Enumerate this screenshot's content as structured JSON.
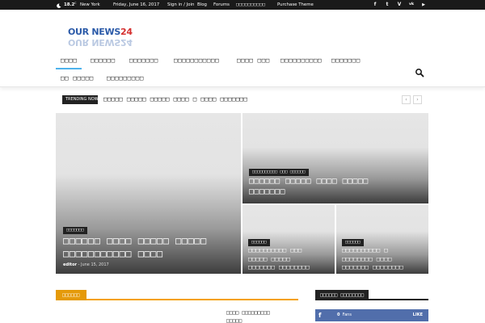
{
  "topbar": {
    "temperature": "18.2",
    "temp_unit": "C",
    "city": "New York",
    "date": "Friday, June 16, 2017",
    "links": [
      "Sign in / Join",
      "Blog",
      "Forums",
      "□□□□□□□□□□",
      "Purchase Theme"
    ],
    "social": [
      "f",
      "t",
      "V",
      "vk",
      "▶"
    ]
  },
  "logo": {
    "text_blue": "OUR NEWS",
    "text_red": "24"
  },
  "nav": {
    "items": [
      "□□□□",
      "□□□□□□",
      "□□□□□□□",
      "□□□□□□□□□□□",
      "□□□□ □□□",
      "□□□□□□□□□□",
      "□□□□□□□",
      "□□ □□□□□",
      "□□□□□□□□□"
    ],
    "active_index": 0
  },
  "trending": {
    "label": "TRENDING NOW",
    "title": "□□□□□ □□□□□ □□□□□ □□□□ □ □□□□ □□□□□□□",
    "prev": "‹",
    "next": "›"
  },
  "featured": {
    "big": {
      "category": "□□□□□□□",
      "title_line1": "□□□□□□ □□□□ □□□□□ □□□□□",
      "title_line2": "□□□□□□□□□□□ □□□□",
      "author": "editor",
      "date": "June 15, 2017"
    },
    "top_right": {
      "category": "□□□□□□□□□□ □□□ □□□□□□",
      "title_line1": "□□□□□□ □□□□□ □□□□ □□□□□",
      "title_line2": "□□□□□□□"
    },
    "bottom_left": {
      "category": "□□□□□□",
      "title_line1": "□□□□□□□□□□ □□□",
      "title_line2": "□□□□□ □□□□□",
      "title_line3": "□□□□□□□ □□□□□□□□"
    },
    "bottom_right": {
      "category": "□□□□□□",
      "title_line1": "□□□□□□□□□□ □",
      "title_line2": "□□□□□□□□ □□□□",
      "title_line3": "□□□□□□□ □□□□□□□□"
    }
  },
  "section": {
    "title": "□□□□□□"
  },
  "sidebar": {
    "title": "□□□□□□ □□□□□□□□",
    "post_line1": "□□□□ □□□□□□□□□",
    "post_line2": "□□□□□",
    "facebook": {
      "icon": "f",
      "count": "0",
      "count_label": "Fans",
      "action": "LIKE"
    }
  },
  "colors": {
    "topbar_bg": "#1a1a1a",
    "nav_accent": "#4db2ec",
    "section_accent": "#e59a0a",
    "facebook": "#516eab",
    "logo_blue": "#2b5aa8",
    "logo_red": "#d5302f"
  }
}
